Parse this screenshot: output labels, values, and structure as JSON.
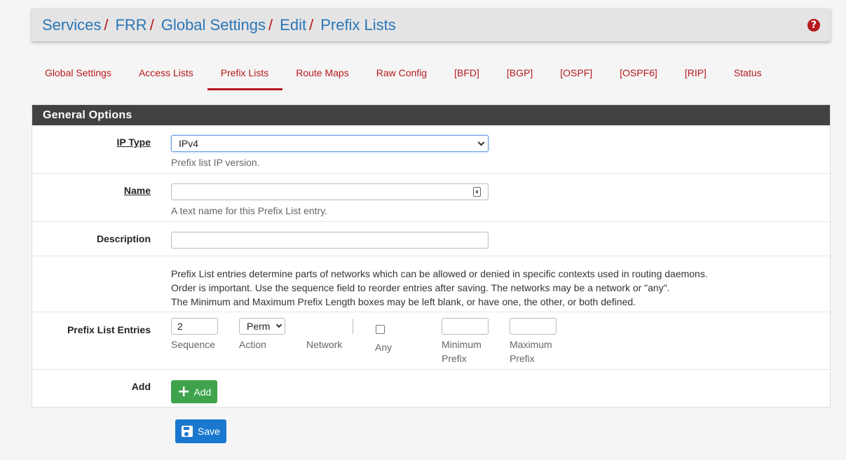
{
  "breadcrumb": [
    "Services",
    "FRR",
    "Global Settings",
    "Edit",
    "Prefix Lists"
  ],
  "tabs": [
    "Global Settings",
    "Access Lists",
    "Prefix Lists",
    "Route Maps",
    "Raw Config",
    "[BFD]",
    "[BGP]",
    "[OSPF]",
    "[OSPF6]",
    "[RIP]",
    "Status"
  ],
  "active_tab": "Prefix Lists",
  "panel": {
    "title": "General Options",
    "ip_type": {
      "label": "IP Type",
      "value": "IPv4",
      "help": "Prefix list IP version."
    },
    "name": {
      "label": "Name",
      "value": "",
      "help": "A text name for this Prefix List entry."
    },
    "description": {
      "label": "Description",
      "value": ""
    },
    "info": [
      "Prefix List entries determine parts of networks which can be allowed or denied in specific contexts used in routing daemons.",
      "Order is important. Use the sequence field to reorder entries after saving. The networks may be a network or \"any\".",
      "The Minimum and Maximum Prefix Length boxes may be left blank, or have one, the other, or both defined."
    ],
    "entries": {
      "label": "Prefix List Entries",
      "sequence_value": "2",
      "action_value": "Perm",
      "sequence_label": "Sequence",
      "action_label": "Action",
      "network_label": "Network",
      "any_label": "Any",
      "min_prefix_label": [
        "Minimum",
        "Prefix"
      ],
      "max_prefix_label": [
        "Maximum",
        "Prefix"
      ]
    },
    "add": {
      "label": "Add",
      "button": "Add"
    }
  },
  "save_button": "Save",
  "colors": {
    "link": "#2a76b8",
    "accent": "#b7191c",
    "add": "#3ea34c",
    "save": "#1b78cf"
  },
  "icons": [
    "help-icon",
    "chevron-down-icon",
    "password-key-icon",
    "plus-icon",
    "floppy-disk-icon"
  ]
}
